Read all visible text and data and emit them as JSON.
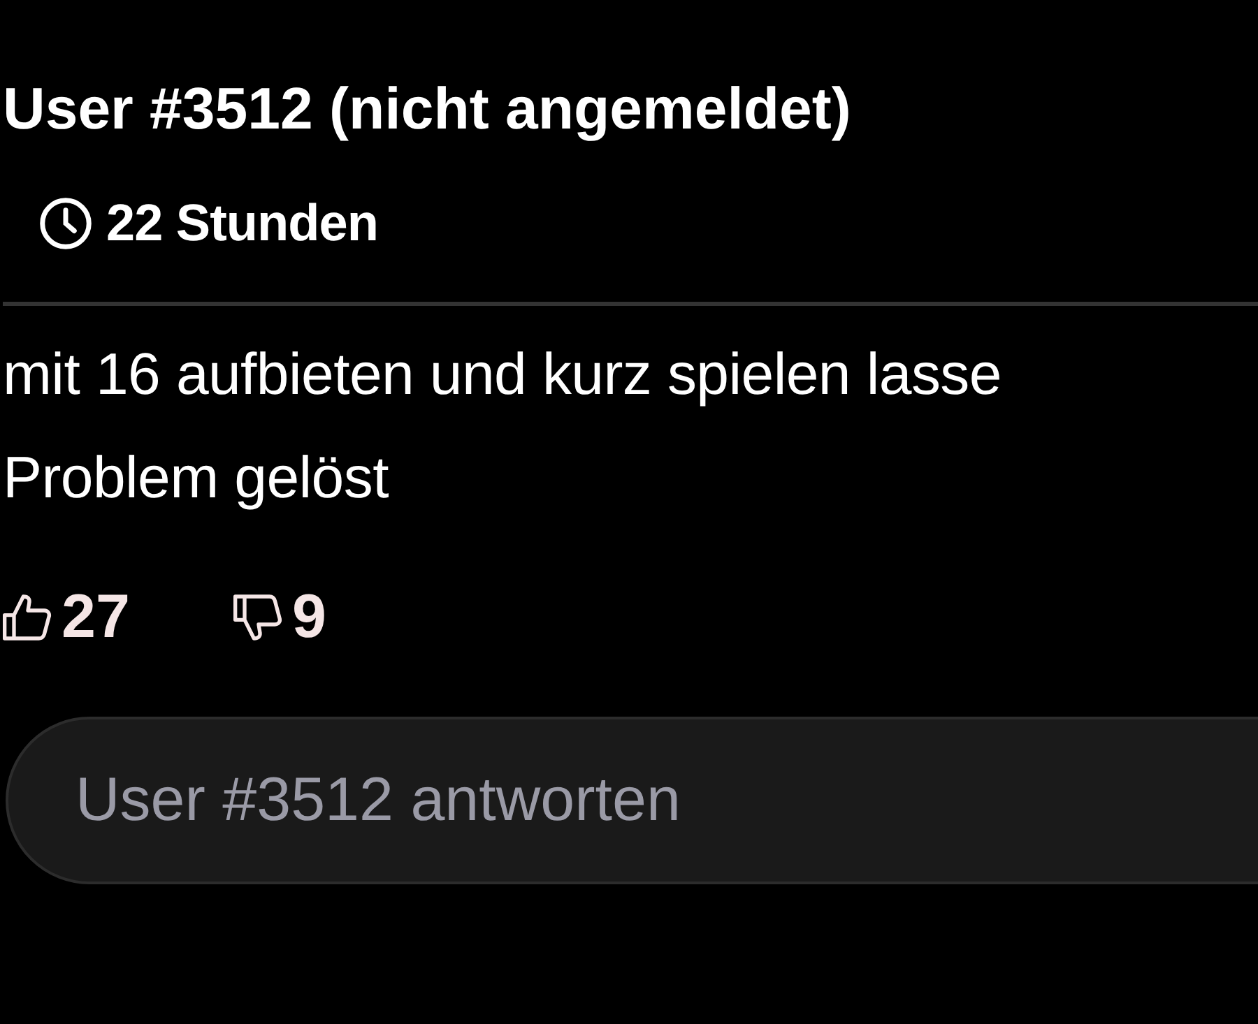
{
  "comment": {
    "author": "User #3512 (nicht angemeldet)",
    "age": "22 Stunden",
    "body_lines": [
      "mit 16 aufbieten und kurz spielen lasse",
      "Problem gelöst"
    ],
    "likes": "27",
    "dislikes": "9"
  },
  "reply": {
    "placeholder": "User #3512 antworten"
  }
}
